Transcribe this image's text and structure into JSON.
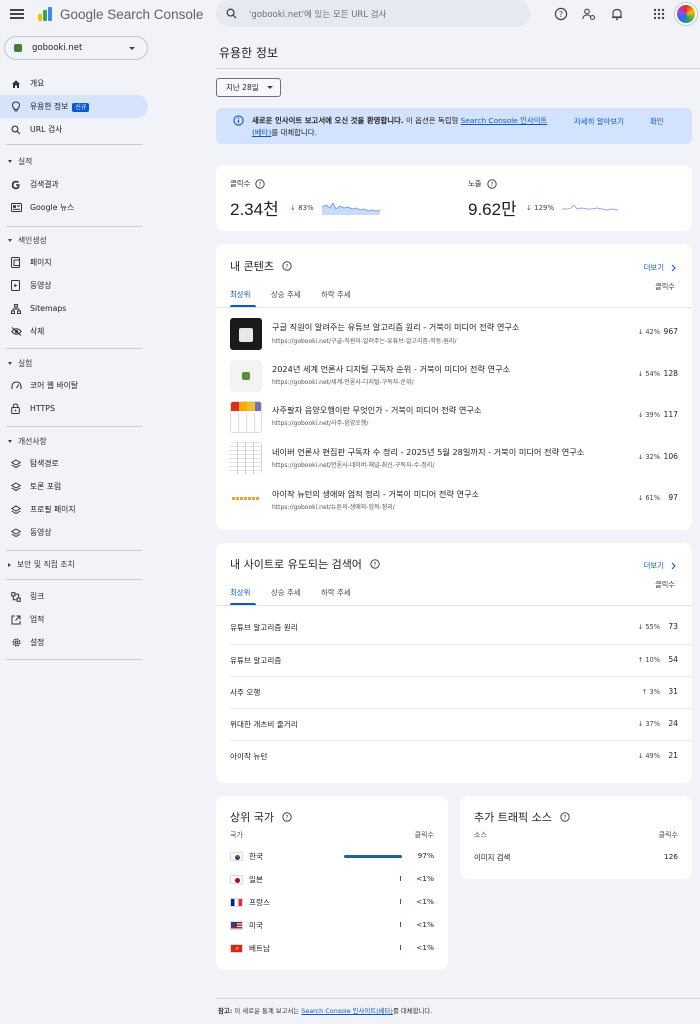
{
  "header": {
    "app_name": "Google Search Console",
    "search_placeholder": "'gobooki.net'에 있는 모든 URL 검사"
  },
  "sidebar": {
    "property": "gobooki.net",
    "items": [
      {
        "label": "개요",
        "icon": "home-icon"
      },
      {
        "label": "유용한 정보",
        "icon": "lightbulb-icon",
        "badge": "신규",
        "active": true
      },
      {
        "label": "URL 검사",
        "icon": "search-icon"
      }
    ],
    "sections": [
      {
        "title": "실적",
        "items": [
          {
            "label": "검색결과",
            "icon": "google-g-icon"
          },
          {
            "label": "Google 뉴스",
            "icon": "news-icon"
          }
        ]
      },
      {
        "title": "색인생성",
        "items": [
          {
            "label": "페이지",
            "icon": "page-icon"
          },
          {
            "label": "동영상",
            "icon": "video-page-icon"
          },
          {
            "label": "Sitemaps",
            "icon": "sitemap-icon"
          },
          {
            "label": "삭제",
            "icon": "eye-off-icon"
          }
        ]
      },
      {
        "title": "실험",
        "items": [
          {
            "label": "코어 웹 바이탈",
            "icon": "gauge-icon"
          },
          {
            "label": "HTTPS",
            "icon": "lock-icon"
          }
        ]
      },
      {
        "title": "개선사항",
        "items": [
          {
            "label": "탐색경로",
            "icon": "layers-icon"
          },
          {
            "label": "토론 포럼",
            "icon": "layers-icon"
          },
          {
            "label": "프로필 페이지",
            "icon": "layers-icon"
          },
          {
            "label": "동영상",
            "icon": "layers-icon"
          }
        ]
      },
      {
        "title": "보안 및 직접 조치",
        "items": []
      }
    ],
    "bottom_items": [
      {
        "label": "링크",
        "icon": "link-icon"
      },
      {
        "label": "업적",
        "icon": "external-icon"
      },
      {
        "label": "설정",
        "icon": "gear-icon"
      }
    ]
  },
  "main": {
    "title": "유용한 정보",
    "date_range": "지난 28일",
    "banner": {
      "bold": "새로운 인사이트 보고서에 오신 것을 환영합니다.",
      "text_before_link": " 이 옵션은 독립형 ",
      "link": "Search Console 인사이트(베타)",
      "text_after_link": "를 대체합니다.",
      "learn_more": "자세히 알아보기",
      "ok": "확인"
    },
    "metrics": {
      "clicks": {
        "label": "클릭수",
        "value": "2.34천",
        "change": "83%",
        "direction": "down"
      },
      "impressions": {
        "label": "노출",
        "value": "9.62만",
        "change": "129%",
        "direction": "down"
      }
    },
    "content_card": {
      "title": "내 콘텐츠",
      "more": "더보기",
      "tabs": [
        "최상위",
        "상승 추세",
        "하락 추세"
      ],
      "col_header": "클릭수",
      "rows": [
        {
          "title": "구글 직원이 알려주는 유튜브 알고리즘 원리 - 거북이 미디어 전략 연구소",
          "url": "https://gobooki.net/구글-직원이-알려주는-유튜브-알고리즘-작동-원리/",
          "change": "42%",
          "direction": "down",
          "value": "967"
        },
        {
          "title": "2024년 세계 언론사 디지털 구독자 순위 - 거북이 미디어 전략 연구소",
          "url": "https://gobooki.net/세계-언론사-디지털-구독자-순위/",
          "change": "54%",
          "direction": "down",
          "value": "128"
        },
        {
          "title": "사주팔자 음양오행이란 무엇인가 - 거북이 미디어 전략 연구소",
          "url": "https://gobooki.net/사주-음양오행/",
          "change": "39%",
          "direction": "down",
          "value": "117"
        },
        {
          "title": "네이버 언론사 편집판 구독자 수 정리 - 2025년 5월 28일까지 - 거북이 미디어 전략 연구소",
          "url": "https://gobooki.net/언론사-네이버-채널-최신-구독자-수-정리/",
          "change": "32%",
          "direction": "down",
          "value": "106"
        },
        {
          "title": "아이작 뉴턴의 생애와 업적 정리 - 거북이 미디어 전략 연구소",
          "url": "https://gobooki.net/뉴튼의-생애와-업적-정리/",
          "change": "61%",
          "direction": "down",
          "value": "97"
        }
      ]
    },
    "queries_card": {
      "title": "내 사이트로 유도되는 검색어",
      "more": "더보기",
      "tabs": [
        "최상위",
        "상승 추세",
        "하락 추세"
      ],
      "col_header": "클릭수",
      "rows": [
        {
          "query": "유튜브 알고리즘 원리",
          "change": "55%",
          "direction": "down",
          "value": "73"
        },
        {
          "query": "유튜브 알고리즘",
          "change": "10%",
          "direction": "up",
          "value": "54"
        },
        {
          "query": "사주 오행",
          "change": "3%",
          "direction": "up",
          "value": "31"
        },
        {
          "query": "위대한 개츠비 줄거리",
          "change": "37%",
          "direction": "down",
          "value": "24"
        },
        {
          "query": "아이작 뉴턴",
          "change": "49%",
          "direction": "down",
          "value": "21"
        }
      ]
    },
    "countries_card": {
      "title": "상위 국가",
      "col_left": "국가",
      "col_right": "클릭수",
      "rows": [
        {
          "name": "한국",
          "flag": "kr",
          "value": "97%",
          "share": 0.97
        },
        {
          "name": "일본",
          "flag": "jp",
          "value": "<1%",
          "share": 0.01
        },
        {
          "name": "프랑스",
          "flag": "fr",
          "value": "<1%",
          "share": 0.01
        },
        {
          "name": "미국",
          "flag": "us",
          "value": "<1%",
          "share": 0.01
        },
        {
          "name": "베트남",
          "flag": "vn",
          "value": "<1%",
          "share": 0.01
        }
      ]
    },
    "traffic_card": {
      "title": "추가 트래픽 소스",
      "col_left": "소스",
      "col_right": "클릭수",
      "rows": [
        {
          "name": "이미지 검색",
          "value": "126"
        }
      ]
    },
    "footer": {
      "prefix": "참고:",
      "text": " 이 새로운 통계 보고서는 ",
      "link": "Search Console 인사이트(베타)",
      "suffix": "를 대체합니다."
    }
  },
  "colors": {
    "accent": "#0b57d0",
    "active_nav": "#d5e3fc",
    "banner": "#d3e3fd",
    "down": "#c5221f",
    "up": "#188038",
    "bar": "#18668c"
  }
}
